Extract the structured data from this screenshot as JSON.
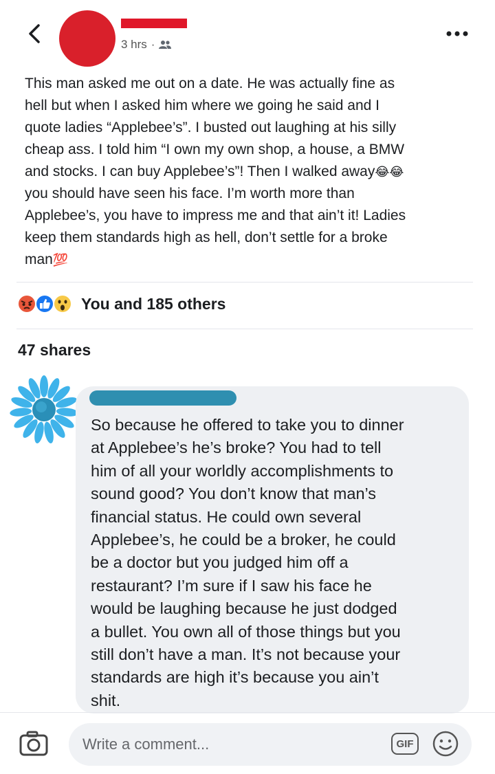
{
  "header": {
    "back_icon": "chevron-left-icon",
    "timestamp": "3 hrs",
    "separator": "·",
    "audience_icon": "friends-icon",
    "more_icon": "more-horizontal-icon"
  },
  "post": {
    "text_part1": "This man asked me out on a date. He was actually fine as\nhell but when I asked him where we going he said and I\nquote ladies “Applebee’s”. I busted out laughing at his silly\ncheap ass. I told him “I own my own shop, a house, a BMW\nand stocks. I can buy Applebee’s”! Then I walked away",
    "emoji_laugh": "😂😂",
    "text_part2": "\nyou should have seen his face. I’m worth more than\nApplebee’s, you have to impress me and that ain’t it! Ladies\nkeep them standards high as hell, don’t settle for a broke\nman",
    "emoji_100": "💯"
  },
  "reactions": {
    "icons": [
      "angry-reaction-icon",
      "like-reaction-icon",
      "wow-reaction-icon"
    ],
    "label": "You and 185 others"
  },
  "shares": {
    "label": "47 shares"
  },
  "comment": {
    "text": "So because he offered to take you to dinner\nat Applebee’s he’s broke? You had to tell\nhim of all your worldly accomplishments to\nsound good? You don’t know that man’s\nfinancial status. He could own several\nApplebee’s, he could be a broker, he could\nbe a doctor but you judged him off a\nrestaurant? I’m sure if I saw his face he\nwould be laughing because he just dodged\na bullet. You own all of those things but you\nstill don’t have a man. It’s not because your\nstandards are high it’s because you ain’t\nshit."
  },
  "composer": {
    "camera_icon": "camera-icon",
    "placeholder": "Write a comment...",
    "gif_label": "GIF",
    "emoji_icon": "smiley-icon"
  },
  "colors": {
    "redaction_red": "#e0182a",
    "redaction_blue": "#2f8fb0",
    "like_blue": "#1877f2",
    "angry_orange": "#e8563a",
    "wow_yellow": "#f7c948"
  }
}
